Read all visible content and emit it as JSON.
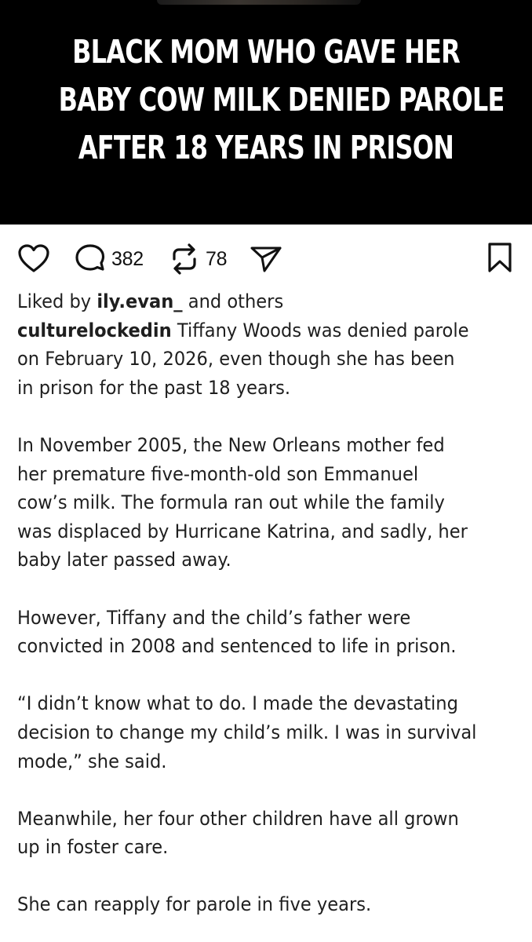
{
  "post": {
    "headline_lines": [
      "BLACK MOM WHO GAVE HER",
      "BABY COW MILK DENIED PAROLE",
      "AFTER 18 YEARS IN PRISON"
    ],
    "actions": {
      "like_icon": "heart-icon",
      "comment_icon": "comment-bubble-icon",
      "comment_count": "382",
      "repost_icon": "repost-arrows-icon",
      "repost_count": "78",
      "share_icon": "send-paper-plane-icon",
      "save_icon": "bookmark-icon"
    },
    "likes": {
      "prefix": "Liked by ",
      "user": "ily.evan_",
      "suffix": " and others"
    },
    "caption": {
      "username": "culturelockedin",
      "first_line": " Tiffany Woods was denied parole",
      "lines": [
        "on February 10, 2026, even though she has been",
        "in prison for the past 18 years."
      ],
      "para2": [
        "In November 2005, the New Orleans mother fed",
        "her premature five-month-old son Emmanuel",
        "cow’s milk. The formula ran out while the family",
        "was displaced by Hurricane Katrina, and sadly, her",
        "baby later passed away."
      ],
      "para3": [
        "However, Tiffany and the child’s father were",
        "convicted in 2008 and sentenced to life in prison."
      ],
      "para4": [
        "“I didn’t know what to do. I made the devastating",
        "decision to change my child’s milk. I was in survival",
        "mode,” she said."
      ],
      "para5": [
        "Meanwhile, her four other children have all grown",
        "up in foster care."
      ],
      "para6": [
        "She can reapply for parole in five years."
      ]
    }
  }
}
